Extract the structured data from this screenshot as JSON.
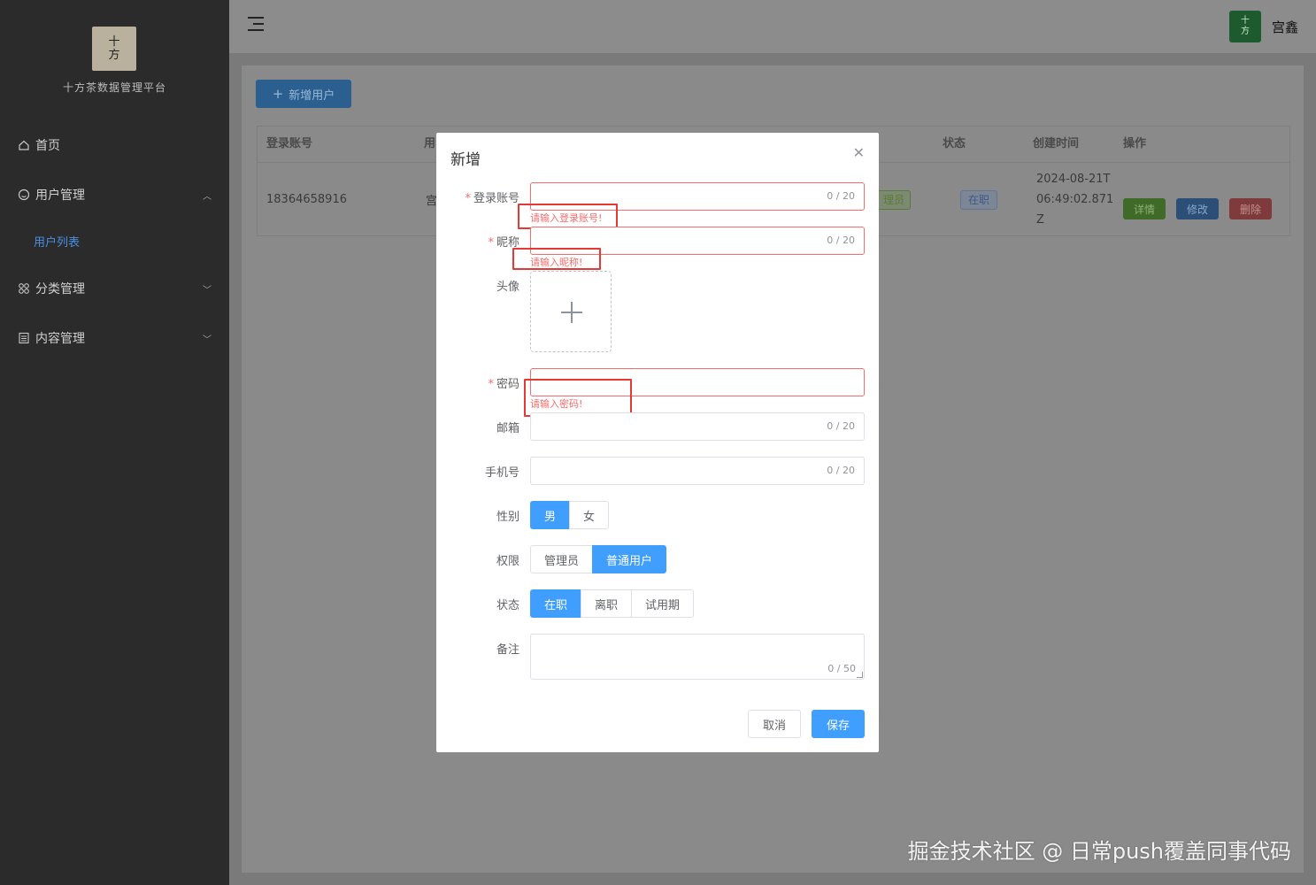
{
  "sidebar": {
    "logo_line1": "十",
    "logo_line2": "方",
    "platform_name": "十方茶数据管理平台",
    "items": [
      {
        "label": "首页",
        "icon": "home-icon"
      },
      {
        "label": "用户管理",
        "icon": "user-circle-icon",
        "expanded": true
      },
      {
        "label": "用户列表",
        "sub": true,
        "active": true
      },
      {
        "label": "分类管理",
        "icon": "grid-icon"
      },
      {
        "label": "内容管理",
        "icon": "document-icon"
      }
    ]
  },
  "header": {
    "avatar_line1": "十",
    "avatar_line2": "方",
    "user_name": "宫鑫"
  },
  "toolbar": {
    "add_user_label": "新增用户"
  },
  "table": {
    "columns": [
      "登录账号",
      "用",
      "状态",
      "创建时间",
      "操作"
    ],
    "rows": [
      {
        "login": "18364658916",
        "nick": "宫",
        "role": "理员",
        "status": "在职",
        "created": "2024-08-21T06:49:02.871Z",
        "actions": [
          "详情",
          "修改",
          "删除"
        ]
      }
    ]
  },
  "dialog": {
    "title": "新增",
    "fields": {
      "login": {
        "label": "登录账号",
        "required": true,
        "count": "0 / 20",
        "error": "请输入登录账号!"
      },
      "nickname": {
        "label": "昵称",
        "required": true,
        "count": "0 / 20",
        "error": "请输入昵称!"
      },
      "avatar": {
        "label": "头像"
      },
      "password": {
        "label": "密码",
        "required": true,
        "error": "请输入密码!"
      },
      "email": {
        "label": "邮箱",
        "count": "0 / 20"
      },
      "phone": {
        "label": "手机号",
        "count": "0 / 20"
      },
      "gender": {
        "label": "性别",
        "options": [
          "男",
          "女"
        ],
        "selected": "男"
      },
      "permission": {
        "label": "权限",
        "options": [
          "管理员",
          "普通用户"
        ],
        "selected": "普通用户"
      },
      "status": {
        "label": "状态",
        "options": [
          "在职",
          "离职",
          "试用期"
        ],
        "selected": "在职"
      },
      "remark": {
        "label": "备注",
        "count": "0 / 50"
      }
    },
    "cancel_label": "取消",
    "save_label": "保存"
  },
  "watermark": "掘金技术社区 @ 日常push覆盖同事代码",
  "colors": {
    "primary": "#409eff",
    "error": "#f56c6c",
    "highlight_box": "#e53935",
    "sidebar_bg": "#2b2b2b",
    "success_btn": "#4e9a2a",
    "danger_btn": "#c0392b"
  }
}
